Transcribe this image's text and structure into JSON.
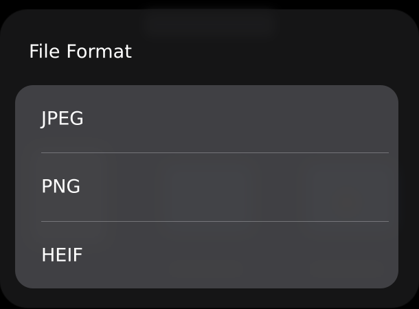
{
  "sheet": {
    "title": "File Format"
  },
  "options": [
    {
      "label": "JPEG"
    },
    {
      "label": "PNG"
    },
    {
      "label": "HEIF"
    }
  ],
  "colors": {
    "background": "#000000",
    "sheet": "#18181a",
    "card": "#4a4a4e",
    "text": "#ffffff"
  }
}
